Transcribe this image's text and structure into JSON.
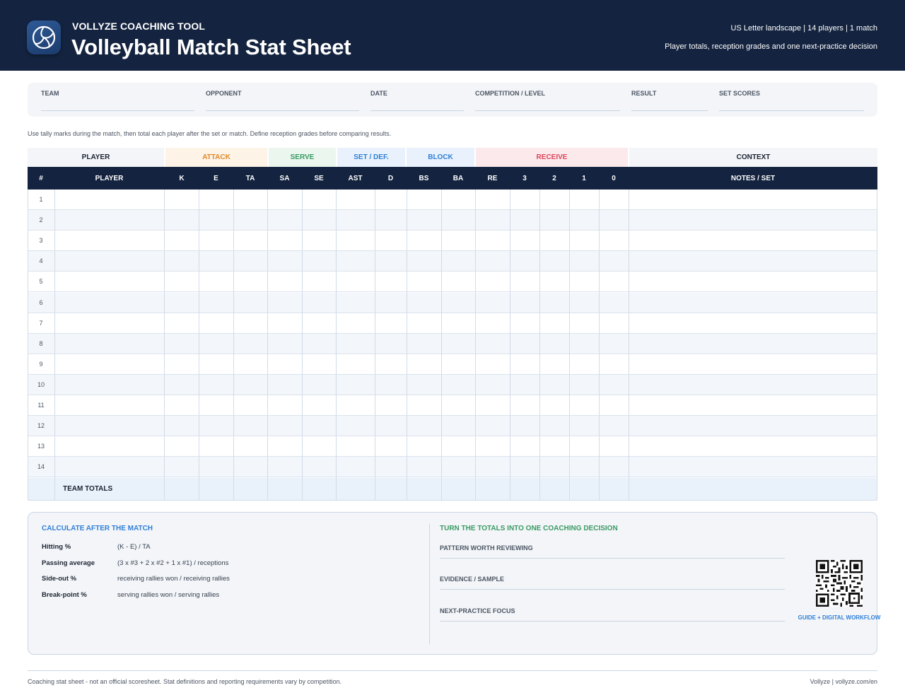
{
  "header": {
    "brand": "VOLLYZE COACHING TOOL",
    "title": "Volleyball Match Stat Sheet",
    "meta_line1": "US Letter landscape | 14 players | 1 match",
    "meta_line2": "Player totals, reception grades and one next-practice decision",
    "logo_icon": "volleyball-icon"
  },
  "match_info": {
    "fields": [
      "TEAM",
      "OPPONENT",
      "DATE",
      "COMPETITION / LEVEL",
      "RESULT",
      "SET SCORES"
    ]
  },
  "instructions": "Use tally marks during the match, then total each player after the set or match. Define reception grades before comparing results.",
  "table": {
    "groups": [
      {
        "label": "PLAYER",
        "color": "#1c2433",
        "bg": "#f3f5f8"
      },
      {
        "label": "ATTACK",
        "color": "#e08a2c",
        "bg": "#fdf3e6"
      },
      {
        "label": "SERVE",
        "color": "#3a9a63",
        "bg": "#ebf6ef"
      },
      {
        "label": "SET / DEF.",
        "color": "#2f7fd8",
        "bg": "#e9f2fc"
      },
      {
        "label": "BLOCK",
        "color": "#2f7fd8",
        "bg": "#e9f2fc"
      },
      {
        "label": "RECEIVE",
        "color": "#d9475a",
        "bg": "#fce9ec"
      },
      {
        "label": "CONTEXT",
        "color": "#1c2433",
        "bg": "#f3f5f8"
      }
    ],
    "columns": [
      "#",
      "PLAYER",
      "K",
      "E",
      "TA",
      "SA",
      "SE",
      "AST",
      "D",
      "BS",
      "BA",
      "RE",
      "3",
      "2",
      "1",
      "0",
      "NOTES / SET"
    ],
    "rows": [
      "1",
      "2",
      "3",
      "4",
      "5",
      "6",
      "7",
      "8",
      "9",
      "10",
      "11",
      "12",
      "13",
      "14"
    ],
    "totals_label": "TEAM TOTALS",
    "header_bg": "#14233f"
  },
  "calculations": {
    "heading": "CALCULATE AFTER THE MATCH",
    "items": [
      {
        "name": "Hitting %",
        "formula": "(K - E) / TA"
      },
      {
        "name": "Passing average",
        "formula": "(3 x #3 + 2 x #2 + 1 x #1) / receptions"
      },
      {
        "name": "Side-out %",
        "formula": "receiving rallies won / receiving rallies"
      },
      {
        "name": "Break-point %",
        "formula": "serving rallies won / serving rallies"
      }
    ]
  },
  "decision": {
    "heading": "TURN THE TOTALS INTO ONE COACHING DECISION",
    "fields": [
      "PATTERN WORTH REVIEWING",
      "EVIDENCE / SAMPLE",
      "NEXT-PRACTICE FOCUS"
    ]
  },
  "qr": {
    "label": "GUIDE + DIGITAL WORKFLOW",
    "icon": "qr-code-icon"
  },
  "footer": {
    "left": "Coaching stat sheet - not an official scoresheet. Stat definitions and reporting requirements vary by competition.",
    "right": "Vollyze | vollyze.com/en"
  },
  "colors": {
    "navy": "#14233f",
    "blue_accent": "#2f7fd8",
    "green_accent": "#3a9a63"
  }
}
